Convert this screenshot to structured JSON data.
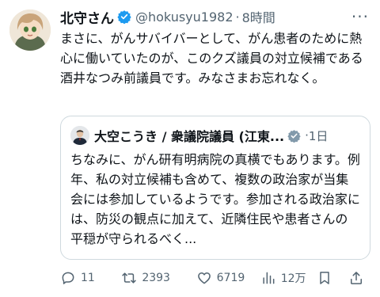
{
  "tweet": {
    "display_name": "北守さん",
    "handle": "@hokusyu1982",
    "dot": "·",
    "time": "8時間",
    "body": "まさに、がんサバイバーとして、がん患者のために熱心に働いていたのが、このクズ議員の対立候補である酒井なつみ前議員です。みなさまお忘れなく。",
    "more_label": "···"
  },
  "quote": {
    "display_name": "大空こうき / 衆議院議員 (江東...",
    "dot": "·",
    "time": "1日",
    "body": "ちなみに、がん研有明病院の真横でもあります。例年、私の対立候補も含めて、複数の政治家が当集会には参加しているようです。参加される政治家には、防災の観点に加えて、近隣住民や患者さんの平穏が守られるべく..."
  },
  "actions": {
    "reply_count": "11",
    "retweet_count": "2393",
    "like_count": "6719",
    "view_count": "12万"
  },
  "colors": {
    "verified": "#1d9bf0",
    "secondary_text": "#536471",
    "border": "#cfd9de"
  },
  "icons": [
    "verified-badge-icon",
    "more-icon",
    "reply-icon",
    "retweet-icon",
    "like-icon",
    "views-icon",
    "bookmark-icon",
    "share-icon"
  ]
}
